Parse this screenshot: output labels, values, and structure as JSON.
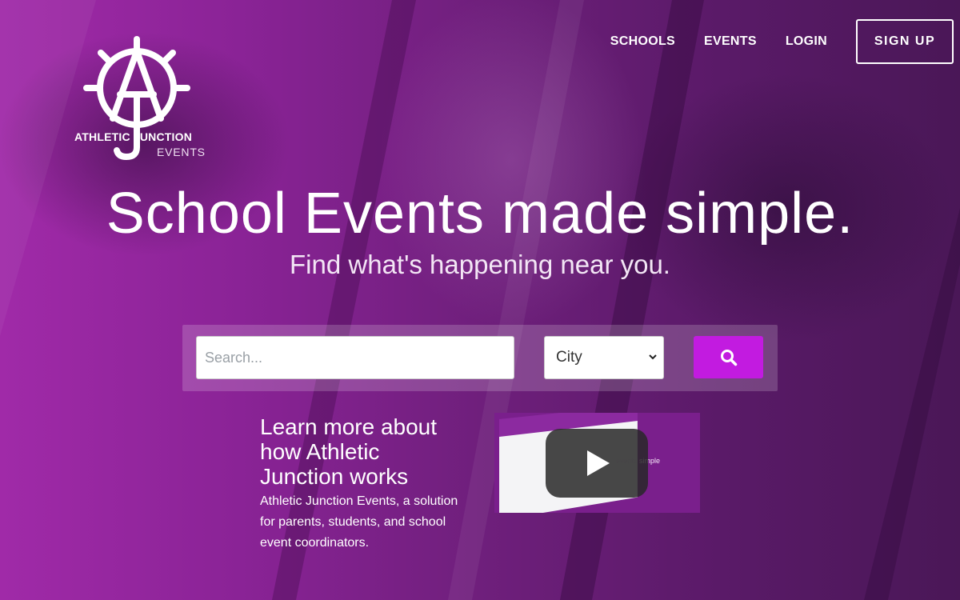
{
  "brand": {
    "logo_alt": "Athletic Junction Events",
    "name_line": "ATHLETIC JUNCTION",
    "sub_line": "EVENTS"
  },
  "nav": {
    "schools": "SCHOOLS",
    "events": "EVENTS",
    "login": "LOGIN",
    "signup": "SIGN UP"
  },
  "hero": {
    "headline": "School Events made simple.",
    "subhead": "Find what's happening near you."
  },
  "search": {
    "placeholder": "Search...",
    "value": "",
    "city_selected": "City",
    "button_icon": "search-icon"
  },
  "learn": {
    "title": "Learn more about how Athletic Junction works",
    "body": "Athletic Junction Events, a solution for parents, students, and school event coordinators."
  },
  "video": {
    "thumbnail_caption": "events simple",
    "play_icon": "play-icon"
  },
  "colors": {
    "accent": "#c21be0",
    "overlay": "#7a1f8c"
  }
}
